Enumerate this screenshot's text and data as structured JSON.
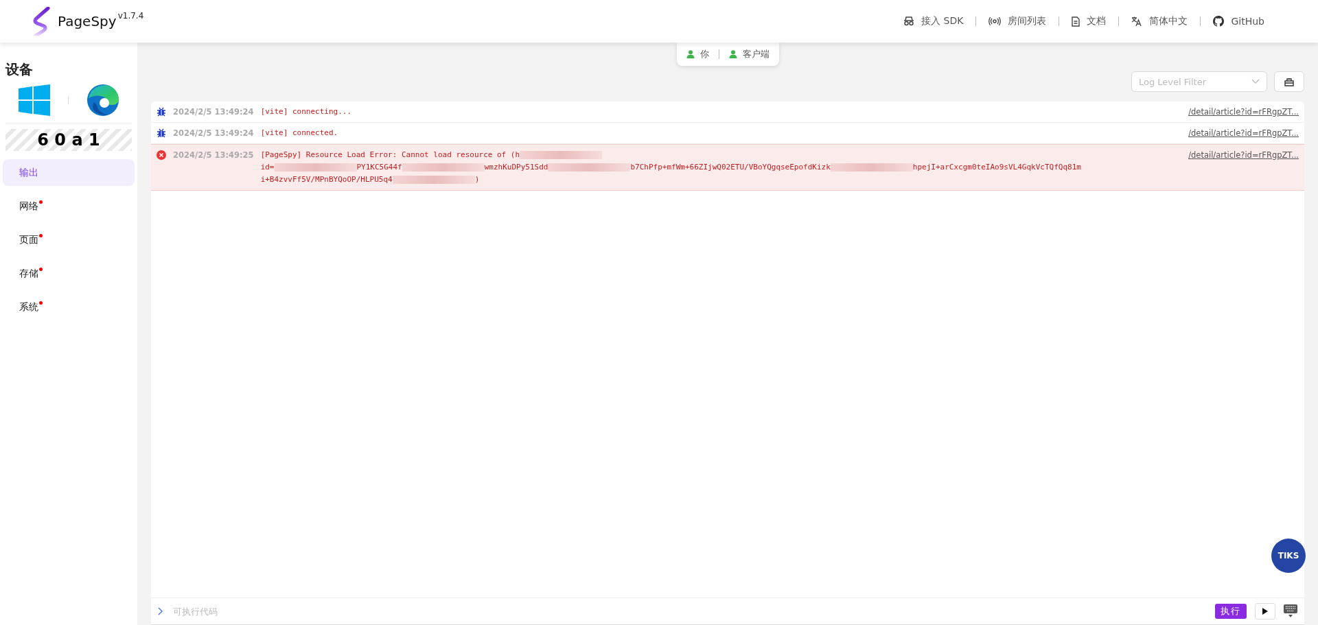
{
  "header": {
    "logo": "PageSpy",
    "version": "v1.7.4",
    "nav": [
      {
        "kind": "sdk",
        "label": "接入 SDK"
      },
      {
        "kind": "rooms",
        "label": "房间列表"
      },
      {
        "kind": "docs",
        "label": "文档"
      },
      {
        "kind": "lang",
        "label": "简体中文"
      },
      {
        "kind": "github",
        "label": "GitHub"
      }
    ]
  },
  "sidebar": {
    "title": "设备",
    "device_id": "6 0 a 1",
    "items": [
      {
        "label": "输出",
        "selected": true,
        "badge": false
      },
      {
        "label": "网络",
        "selected": false,
        "badge": true
      },
      {
        "label": "页面",
        "selected": false,
        "badge": true
      },
      {
        "label": "存储",
        "selected": false,
        "badge": true
      },
      {
        "label": "系统",
        "selected": false,
        "badge": true
      }
    ]
  },
  "peers": [
    "你",
    "客户端"
  ],
  "filter": {
    "placeholder": "Log Level Filter"
  },
  "logs": [
    {
      "kind": "debug",
      "time": "2024/2/5 13:49:24",
      "lines": [
        [
          {
            "text": "[vite] connecting..."
          }
        ]
      ],
      "source": "/detail/article?id=rFRgpZT..."
    },
    {
      "kind": "debug",
      "time": "2024/2/5 13:49:24",
      "lines": [
        [
          {
            "text": "[vite] connected."
          }
        ]
      ],
      "source": "/detail/article?id=rFRgpZT..."
    },
    {
      "kind": "error",
      "time": "2024/2/5 13:49:25",
      "lines": [
        [
          {
            "text": "[PageSpy] Resource Load Error: Cannot load resource of (h"
          },
          {
            "kind": "redacted"
          }
        ],
        [
          {
            "text": "id="
          },
          {
            "kind": "redacted"
          },
          {
            "text": "PY1KC5G44f"
          },
          {
            "kind": "redacted"
          },
          {
            "text": "wmzhKuDPy51Sdd"
          },
          {
            "kind": "redacted"
          },
          {
            "text": "b7ChPfp+mfWm+66ZIjwQ02ETU/VBoYQgqseEpofdKizk"
          },
          {
            "kind": "redacted"
          },
          {
            "text": "hpejI+arCxcgm0teIAo9sVL4GqkVcTQfQq81m"
          }
        ],
        [
          {
            "text": "i+B4zvvFf5V/MPnBYQoOP/HLPU5q4"
          },
          {
            "kind": "redacted"
          },
          {
            "text": ")"
          }
        ]
      ],
      "source": "/detail/article?id=rFRgpZT..."
    }
  ],
  "console": {
    "placeholder": "可执行代码",
    "run": "执行"
  },
  "floating_badge": "TIKS"
}
